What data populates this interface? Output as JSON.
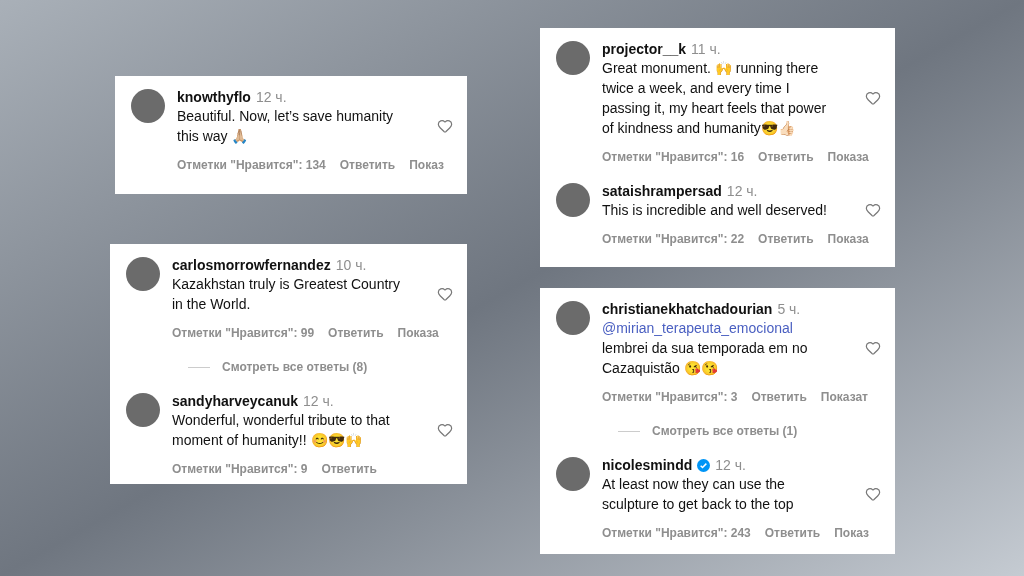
{
  "cards": [
    {
      "items": [
        {
          "kind": "comment",
          "username": "knowthyflo",
          "verified": false,
          "time": "12 ч.",
          "text": "Beautiful. Now, let’s save humanity this way 🙏🏼",
          "likes": "Отметки \"Нравится\": 134",
          "actions": [
            "Ответить",
            "Показ"
          ]
        }
      ]
    },
    {
      "items": [
        {
          "kind": "comment",
          "username": "carlosmorrowfernandez",
          "verified": false,
          "time": "10 ч.",
          "text": "Kazakhstan truly is Greatest Country in the World.",
          "likes": "Отметки \"Нравится\": 99",
          "actions": [
            "Ответить",
            "Показа"
          ]
        },
        {
          "kind": "replies",
          "label": "Смотреть все ответы (8)"
        },
        {
          "kind": "comment",
          "username": "sandyharveycanuk",
          "verified": false,
          "time": "12 ч.",
          "text": "Wonderful, wonderful tribute to that moment of humanity!! 😊😎🙌",
          "likes": "Отметки \"Нравится\": 9",
          "actions": [
            "Ответить"
          ]
        }
      ]
    },
    {
      "items": [
        {
          "kind": "comment",
          "username": "projector__k",
          "verified": false,
          "time": "11 ч.",
          "text": "Great monument. 🙌 running there twice a week, and every time I passing it, my heart feels that power of kindness and humanity😎👍🏻",
          "likes": "Отметки \"Нравится\": 16",
          "actions": [
            "Ответить",
            "Показа"
          ]
        },
        {
          "kind": "comment",
          "username": "sataishrampersad",
          "verified": false,
          "time": "12 ч.",
          "text": "This is incredible and well deserved!",
          "likes": "Отметки \"Нравится\": 22",
          "actions": [
            "Ответить",
            "Показа"
          ]
        }
      ]
    },
    {
      "items": [
        {
          "kind": "comment",
          "username": "christianekhatchadourian",
          "verified": false,
          "time": "5 ч.",
          "mention": "@mirian_terapeuta_emocional",
          "text": "lembrei da sua temporada em no Cazaquistão 😘😘",
          "likes": "Отметки \"Нравится\": 3",
          "actions": [
            "Ответить",
            "Показат"
          ]
        },
        {
          "kind": "replies",
          "label": "Смотреть все ответы (1)"
        },
        {
          "kind": "comment",
          "username": "nicolesmindd",
          "verified": true,
          "time": "12 ч.",
          "text": "At least now they can use the sculpture to get back to the top",
          "likes": "Отметки \"Нравится\": 243",
          "actions": [
            "Ответить",
            "Показ"
          ]
        }
      ]
    }
  ]
}
